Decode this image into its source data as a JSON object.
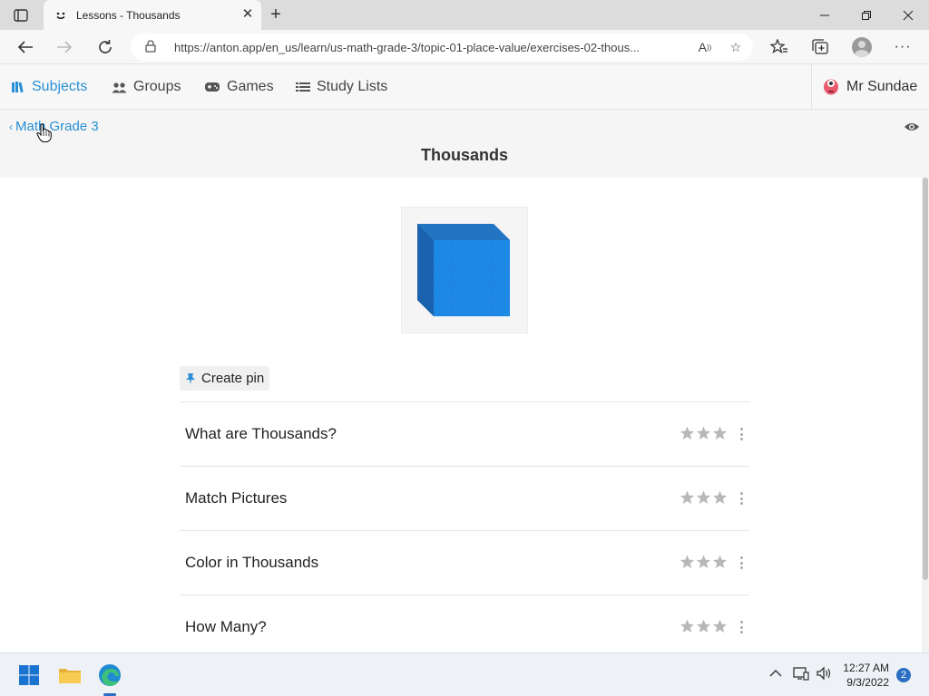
{
  "browser": {
    "tab_title": "Lessons - Thousands",
    "url": "https://anton.app/en_us/learn/us-math-grade-3/topic-01-place-value/exercises-02-thous..."
  },
  "nav": {
    "items": [
      {
        "label": "Subjects",
        "icon": "books-icon",
        "active": true
      },
      {
        "label": "Groups",
        "icon": "users-icon",
        "active": false
      },
      {
        "label": "Games",
        "icon": "gamepad-icon",
        "active": false
      },
      {
        "label": "Study Lists",
        "icon": "list-icon",
        "active": false
      }
    ],
    "user_name": "Mr Sundae"
  },
  "header": {
    "back_label": "Math Grade 3",
    "title": "Thousands"
  },
  "content": {
    "pin_label": "Create pin",
    "lessons": [
      {
        "title": "What are Thousands?",
        "stars": 0
      },
      {
        "title": "Match Pictures",
        "stars": 0
      },
      {
        "title": "Color in Thousands",
        "stars": 0
      },
      {
        "title": "How Many?",
        "stars": 0
      }
    ]
  },
  "taskbar": {
    "time": "12:27 AM",
    "date": "9/3/2022",
    "notifications": "2"
  },
  "colors": {
    "accent": "#2a8fd6",
    "cube": "#1e7fd8",
    "star_empty": "#b8b8b8"
  }
}
